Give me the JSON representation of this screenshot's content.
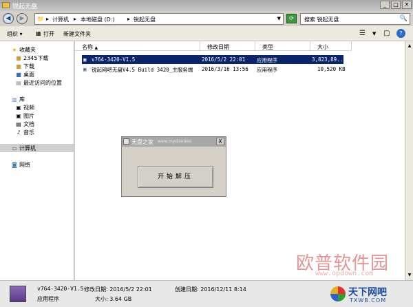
{
  "window": {
    "title": "锐起无盘"
  },
  "address": {
    "crumbs": [
      "计算机",
      "本地磁盘 (D:)",
      "锐起无盘"
    ],
    "search_placeholder": "搜索 锐起无盘"
  },
  "toolbar": {
    "organize": "组织 ▾",
    "open": "打开",
    "new_folder": "新建文件夹"
  },
  "nav": {
    "favorites": "收藏夹",
    "fav_items": [
      "2345下载",
      "下载",
      "桌面",
      "最近访问的位置"
    ],
    "libraries": "库",
    "lib_items": [
      "视频",
      "图片",
      "文档",
      "音乐"
    ],
    "computer": "计算机",
    "network": "网络"
  },
  "columns": {
    "name": "名称",
    "modified": "修改日期",
    "type": "类型",
    "size": "大小"
  },
  "files": [
    {
      "name": "v764-3420-V1.5",
      "modified": "2016/5/2 22:01",
      "type": "应用程序",
      "size": "3,823,89..."
    },
    {
      "name": "锐起网吧无盘V4.5 Build 3420_主服务端",
      "modified": "2016/3/16 13:56",
      "type": "应用程序",
      "size": "10,520 KB"
    }
  ],
  "dialog": {
    "title": "无盘之家",
    "url": "www.mydiskless",
    "close": "X",
    "button": "开始解压"
  },
  "status": {
    "filename": "v764-3420-V1.5",
    "modified_label": "修改日期: 2016/5/2 22:01",
    "created_label": "创建日期: 2016/12/11 8:14",
    "type": "应用程序",
    "size_label": "大小: 3.64 GB"
  },
  "watermark": {
    "text": "欧普软件园",
    "url": "www.opdown.com"
  },
  "logo": {
    "main": "天下网吧",
    "sub": "TXWB.COM"
  }
}
